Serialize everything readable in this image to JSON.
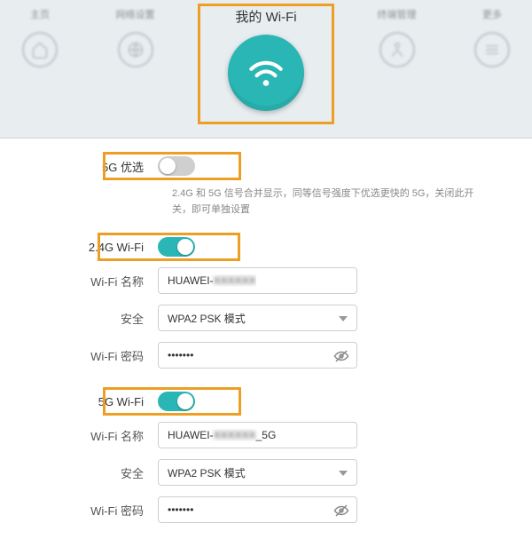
{
  "header": {
    "active_tab_label": "我的 Wi-Fi",
    "nav": [
      "主页",
      "网络设置",
      "我的 Wi-Fi",
      "终端管理",
      "更多"
    ]
  },
  "prefer5g": {
    "label": "5G 优选",
    "enabled_desc": "2.4G 和 5G 信号合并显示，同等信号强度下优选更快的 5G，关闭此开关，即可单独设置"
  },
  "band24": {
    "title": "2.4G Wi-Fi",
    "name_label": "Wi-Fi 名称",
    "name_value_prefix": "HUAWEI-",
    "security_label": "安全",
    "security_value": "WPA2 PSK 模式",
    "password_label": "Wi-Fi 密码",
    "password_value": "•••••••"
  },
  "band5": {
    "title": "5G Wi-Fi",
    "name_label": "Wi-Fi 名称",
    "name_value_prefix": "HUAWEI-",
    "name_value_suffix": "_5G",
    "security_label": "安全",
    "security_value": "WPA2 PSK 模式",
    "password_label": "Wi-Fi 密码",
    "password_value": "•••••••"
  }
}
